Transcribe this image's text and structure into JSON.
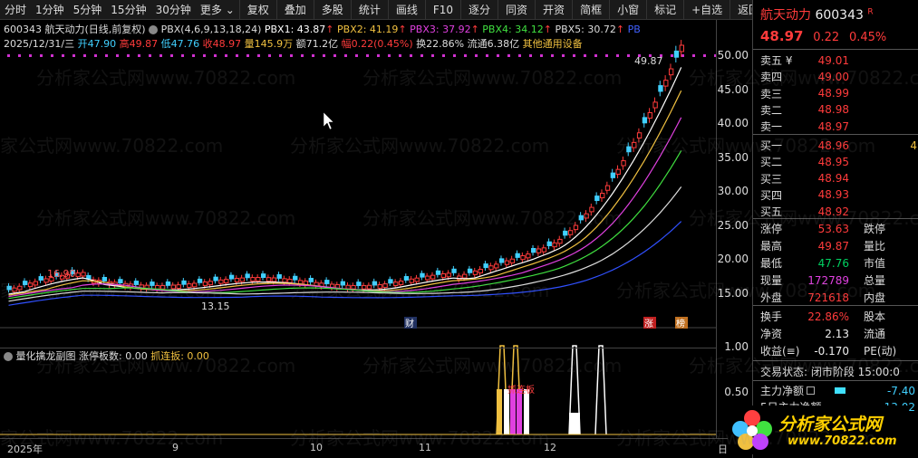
{
  "toolbar": {
    "left": [
      "分时",
      "1分钟",
      "5分钟",
      "15分钟",
      "30分钟",
      "更多"
    ],
    "right": [
      "复权",
      "叠加",
      "多股",
      "统计",
      "画线",
      "F10",
      "逐分",
      "同资",
      "开资",
      "简框",
      "小窗",
      "标记",
      "+自选",
      "返回"
    ]
  },
  "indicator": {
    "code": "600343",
    "name": "航天动力",
    "mode": "(日线,前复权)",
    "formula": "PBX(4,6,9,13,18,24)",
    "pbx1": "PBX1: 43.87",
    "pbx2": "PBX2: 41.19",
    "pbx3": "PBX3: 37.92",
    "pbx4": "PBX4: 34.12",
    "pbx5": "PBX5: 30.72",
    "pbx6": "PB"
  },
  "info": {
    "date": "2025/12/31/三",
    "open": "开47.90",
    "high": "高49.87",
    "low": "低47.76",
    "close": "收48.97",
    "vol": "量145.9万",
    "amt": "额71.2亿",
    "amp": "幅0.22(0.45%)",
    "turn": "换22.86%",
    "float": "流通6.38亿",
    "sector": "其他通用设备"
  },
  "main_chart": {
    "y_ticks": [
      "50.00",
      "45.00",
      "40.00",
      "35.00",
      "30.00",
      "25.00",
      "20.00",
      "15.00"
    ],
    "high_label": "49.87",
    "peak_label": "16.90",
    "low_label": "13.15",
    "marks": [
      "财",
      "涨",
      "榜"
    ]
  },
  "sub_chart": {
    "title": "量化擒龙副图",
    "zt": "涨停板数: 0.00",
    "zl": "抓连扳: 0.00",
    "y_ticks": [
      "1.00",
      "0.50"
    ],
    "label": "抓连板"
  },
  "dates": [
    "2025年",
    "9",
    "10",
    "11",
    "12",
    "日"
  ],
  "panel": {
    "name": "航天动力",
    "code": "600343",
    "flag": "R",
    "price": "48.97",
    "chg": "0.22",
    "pct": "0.45%",
    "sell": [
      {
        "lbl": "卖五 ¥",
        "val": "49.01"
      },
      {
        "lbl": "卖四",
        "val": "49.00"
      },
      {
        "lbl": "卖三",
        "val": "48.99"
      },
      {
        "lbl": "卖二",
        "val": "48.98"
      },
      {
        "lbl": "卖一",
        "val": "48.97"
      }
    ],
    "buy": [
      {
        "lbl": "买一",
        "val": "48.96",
        "extra": "4"
      },
      {
        "lbl": "买二",
        "val": "48.95"
      },
      {
        "lbl": "买三",
        "val": "48.94"
      },
      {
        "lbl": "买四",
        "val": "48.93"
      },
      {
        "lbl": "买五",
        "val": "48.92"
      }
    ],
    "stats": [
      {
        "l1": "涨停",
        "v1": "53.63",
        "l2": "跌停"
      },
      {
        "l1": "最高",
        "v1": "49.87",
        "l2": "量比"
      },
      {
        "l1": "最低",
        "v1": "47.76",
        "l2": "市值"
      },
      {
        "l1": "现量",
        "v1": "172789",
        "l2": "总量"
      },
      {
        "l1": "外盘",
        "v1": "721618",
        "l2": "内盘"
      }
    ],
    "stats2": [
      {
        "l1": "换手",
        "v1": "22.86%",
        "l2": "股本"
      },
      {
        "l1": "净资",
        "v1": "2.13",
        "l2": "流通"
      },
      {
        "l1": "收益(≡)",
        "v1": "-0.170",
        "l2": "PE(动)"
      }
    ],
    "status": "交易状态: 闭市阶段 15:00:0",
    "flow1_lbl": "主力净额",
    "flow1_val": "-7.40",
    "flow2_lbl": "5日主力净额",
    "flow2_val": "-13.02"
  },
  "logo": {
    "title": "分析家公式网",
    "url": "www.70822.com"
  },
  "watermark": "分析家公式网www.70822.com"
}
